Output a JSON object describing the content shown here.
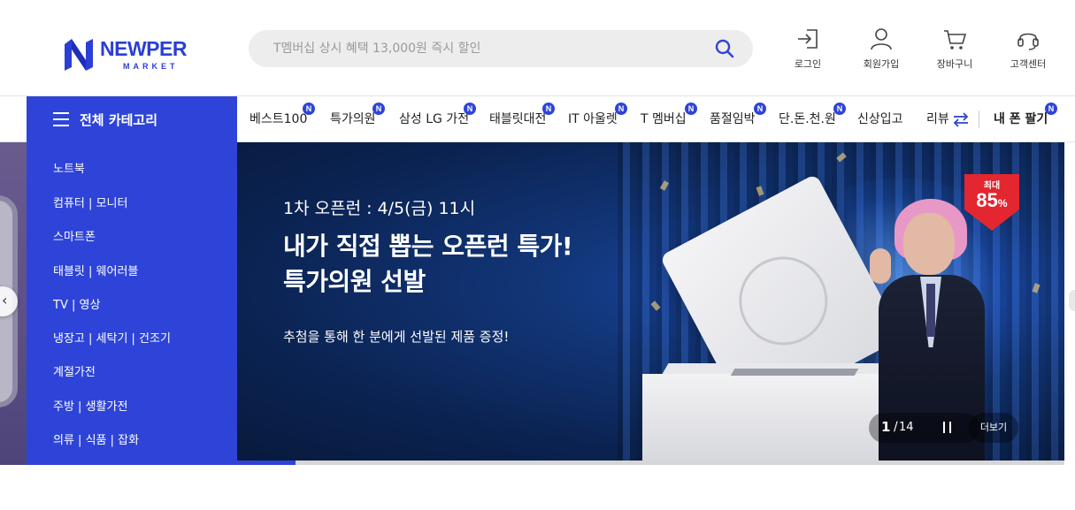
{
  "header": {
    "logo_text": "NEWPER",
    "logo_sub": "MARKET",
    "search": {
      "placeholder": "T멤버십 상시 혜택 13,000원 즉시 할인"
    },
    "utils": [
      {
        "label": "로그인",
        "icon": "login-icon"
      },
      {
        "label": "회원가입",
        "icon": "user-icon"
      },
      {
        "label": "장바구니",
        "icon": "cart-icon"
      },
      {
        "label": "고객센터",
        "icon": "headset-icon"
      }
    ]
  },
  "nav": {
    "all_categories": "전체 카테고리",
    "items": [
      {
        "label": "베스트100",
        "badge": "N"
      },
      {
        "label": "특가의원",
        "badge": "N"
      },
      {
        "label": "삼성 LG 가전",
        "badge": "N"
      },
      {
        "label": "태블릿대전",
        "badge": "N"
      },
      {
        "label": "IT 아울렛",
        "badge": "N"
      },
      {
        "label": "T 멤버십",
        "badge": "N"
      },
      {
        "label": "품절임박",
        "badge": "N"
      },
      {
        "label": "단.돈.천.원",
        "badge": "N"
      },
      {
        "label": "신상입고",
        "badge": ""
      },
      {
        "label": "리뷰",
        "badge": ""
      }
    ],
    "sell_phone": {
      "label": "내 폰 팔기",
      "badge": "N"
    }
  },
  "categories": [
    "노트북",
    "컴퓨터 | 모니터",
    "스마트폰",
    "태블릿 | 웨어러블",
    "TV | 영상",
    "냉장고 | 세탁기 | 건조기",
    "계절가전",
    "주방 | 생활가전",
    "의류 | 식품 | 잡화"
  ],
  "banner": {
    "subtitle": "1차 오픈런 : 4/5(금) 11시",
    "title_line1": "내가 직접 뽑는 오픈런 특가!",
    "title_line2": "특가의원 선발",
    "description": "추첨을 통해 한 분에게 선발된 제품 증정!",
    "tag_small": "최대",
    "tag_value": "85",
    "tag_unit": "%",
    "pager_current": "1",
    "pager_sep": "/",
    "pager_total": "14",
    "more_label": "더보기",
    "progress": 0.071
  },
  "colors": {
    "brand": "#2e44d8",
    "banner_bg": "#0b2352",
    "tag_red": "#e3262f"
  }
}
